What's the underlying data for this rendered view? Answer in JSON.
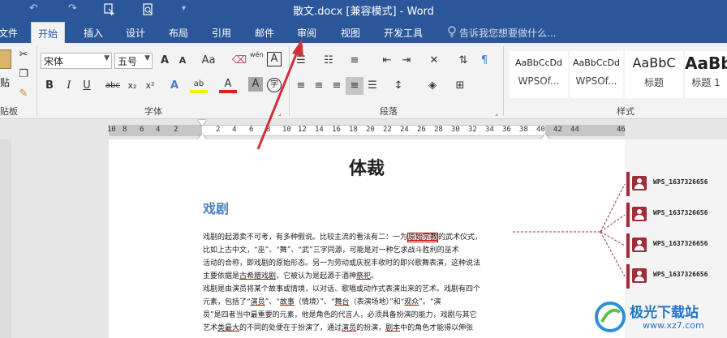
{
  "window": {
    "title": "散文.docx [兼容模式] - Word"
  },
  "quick_access": {
    "undo": "↶",
    "redo": "↷",
    "more": "▾"
  },
  "tabs": [
    {
      "label": "文件"
    },
    {
      "label": "开始"
    },
    {
      "label": "插入"
    },
    {
      "label": "设计"
    },
    {
      "label": "布局"
    },
    {
      "label": "引用"
    },
    {
      "label": "邮件"
    },
    {
      "label": "审阅"
    },
    {
      "label": "视图"
    },
    {
      "label": "开发工具"
    }
  ],
  "tell_me": {
    "placeholder": "告诉我您想要做什么..."
  },
  "clipboard": {
    "paste": "贴",
    "group": "贴板"
  },
  "font": {
    "name": "宋体",
    "size": "五号",
    "group": "字体",
    "grow": "A",
    "shrink": "A",
    "case": "Aa",
    "pinyin": "wén",
    "border": "A",
    "bold": "B",
    "italic": "I",
    "underline": "U",
    "strike": "abc",
    "sub": "x₂",
    "sup": "x²",
    "effects": "A",
    "highlight": "ab",
    "color": "A",
    "shade": "A",
    "circle": "字"
  },
  "paragraph": {
    "group": "段落"
  },
  "styles": {
    "group": "样式",
    "items": [
      {
        "preview": "AaBbCcDd",
        "name": "WPSOf..."
      },
      {
        "preview": "AaBbCcDd",
        "name": "WPSOf..."
      },
      {
        "preview": "AaBbC",
        "name": "标题"
      },
      {
        "preview": "AaBb",
        "name": "标题 1"
      }
    ]
  },
  "ruler": {
    "ticks": [
      "10",
      "8",
      "6",
      "4",
      "2",
      "2",
      "4",
      "6",
      "8",
      "10",
      "12",
      "14",
      "16",
      "18",
      "20",
      "22",
      "24",
      "26",
      "28",
      "30",
      "32",
      "34",
      "36",
      "38",
      "40",
      "42",
      "44",
      "46"
    ]
  },
  "document": {
    "title": "体裁",
    "heading": "戏剧",
    "p1": {
      "l1a": "戏剧的起源卖不可考，有多种假说。比较主流的看法有二：一为",
      "l1_ul": "原始宗教",
      "l1b": "的武术仪式，",
      "l2": "比如上古中文，“巫”、“舞”、“武”三字同源，可能是对一种乞求战斗胜利的巫术",
      "l3": "活动的合称，即戏剧的原始形态。另一为劳动或庆祝丰收时的即兴歌舞表演，这种说法",
      "l4a": "主要依据是",
      "l4_ul": "古希腊戏剧",
      "l4b": "，它被认为是起源于酒神",
      "l4_ul2": "祭祀",
      "l4c": "。"
    },
    "p2": {
      "l1": "戏剧是由演员将某个故事或情境，以对话、歌唱或动作式表演出来的艺术。戏剧有四个",
      "l2a": "元素，包括了“",
      "l2_ul1": "演员",
      "l2b": "”、“",
      "l2_ul2": "故事",
      "l2c": "（情境）”、“",
      "l2_ul3": "舞台",
      "l2d": "（表演场地）”和“",
      "l2_ul4": "观众",
      "l2e": "”。“演",
      "l3": "员”是四者当中最重要的元素，他是角色的代言人，必须具备扮演的能力，戏剧与其它",
      "l4a": "艺术",
      "l4_ul": "类最大",
      "l4b": "的不同的处便在于扮演了，通过",
      "l4_ul2": "演员",
      "l4c": "的扮演，",
      "l4_ul3": "剧本",
      "l4d": "中的角色才能得以伸张"
    }
  },
  "comments": [
    {
      "author": "WPS_1637326656"
    },
    {
      "author": "WPS_1637326656"
    },
    {
      "author": "WPS_1637326656"
    },
    {
      "author": "WPS_1637326656"
    }
  ],
  "watermark": {
    "name": "极光下载站",
    "url": "www.xz7.com"
  },
  "colors": {
    "brand": "#2b579a",
    "heading": "#4a7fc1",
    "comment": "#a12c3a",
    "arrow": "#d0303a"
  }
}
